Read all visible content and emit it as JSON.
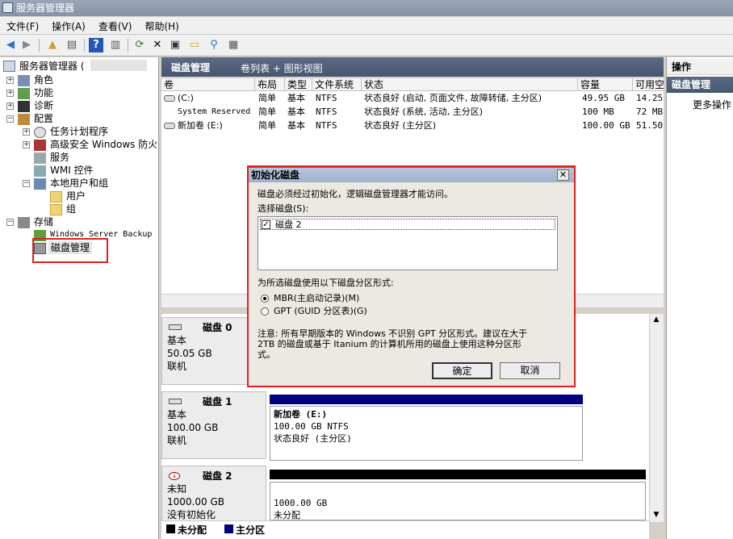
{
  "window": {
    "title": "服务器管理器"
  },
  "menu": [
    "文件(F)",
    "操作(A)",
    "查看(V)",
    "帮助(H)"
  ],
  "tree": {
    "root": "服务器管理器 (",
    "items": [
      "角色",
      "功能",
      "诊断",
      "配置",
      "任务计划程序",
      "高级安全 Windows 防火墙",
      "服务",
      "WMI 控件",
      "本地用户和组",
      "用户",
      "组",
      "存储",
      "Windows Server Backup",
      "磁盘管理"
    ]
  },
  "header": {
    "title": "磁盘管理",
    "view": "卷列表 + 图形视图"
  },
  "columns": [
    "卷",
    "布局",
    "类型",
    "文件系统",
    "状态",
    "容量",
    "可用空"
  ],
  "volumes": [
    {
      "name": "(C:)",
      "layout": "简单",
      "type": "基本",
      "fs": "NTFS",
      "status": "状态良好 (启动, 页面文件, 故障转储, 主分区)",
      "capacity": "49.95 GB",
      "free": "14.25"
    },
    {
      "name": "System Reserved",
      "layout": "简单",
      "type": "基本",
      "fs": "NTFS",
      "status": "状态良好 (系统, 活动, 主分区)",
      "capacity": "100 MB",
      "free": "72 MB"
    },
    {
      "name": "新加卷 (E:)",
      "layout": "简单",
      "type": "基本",
      "fs": "NTFS",
      "status": "状态良好 (主分区)",
      "capacity": "100.00 GB",
      "free": "51.50"
    }
  ],
  "disks": [
    {
      "name": "磁盘 0",
      "type": "基本",
      "size": "50.05 GB",
      "state": "联机"
    },
    {
      "name": "磁盘 1",
      "type": "基本",
      "size": "100.00 GB",
      "state": "联机",
      "part_name": "新加卷 (E:)",
      "part_size": "100.00 GB NTFS",
      "part_status": "状态良好 (主分区)"
    },
    {
      "name": "磁盘 2",
      "type": "未知",
      "size": "1000.00 GB",
      "state": "没有初始化",
      "part_size": "1000.00 GB",
      "part_status": "未分配"
    }
  ],
  "legend": {
    "unallocated": "未分配",
    "primary": "主分区"
  },
  "actions": {
    "title": "操作",
    "section": "磁盘管理",
    "more": "更多操作"
  },
  "dialog": {
    "title": "初始化磁盘",
    "desc": "磁盘必须经过初始化，逻辑磁盘管理器才能访问。",
    "select_label": "选择磁盘(S):",
    "disk_item": "磁盘 2",
    "style_label": "为所选磁盘使用以下磁盘分区形式:",
    "mbr": "MBR(主启动记录)(M)",
    "gpt": "GPT (GUID 分区表)(G)",
    "note1": "注意: 所有早期版本的 Windows 不识别 GPT 分区形式。建议在大于",
    "note2": "2TB 的磁盘或基于 Itanium 的计算机所用的磁盘上使用这种分区形",
    "note3": "式。",
    "ok": "确定",
    "cancel": "取消"
  },
  "colors": {
    "header_bg": "#4f5f79",
    "primary_bar": "#00007f",
    "unalloc_bar": "#000000",
    "highlight": "#e02020"
  }
}
